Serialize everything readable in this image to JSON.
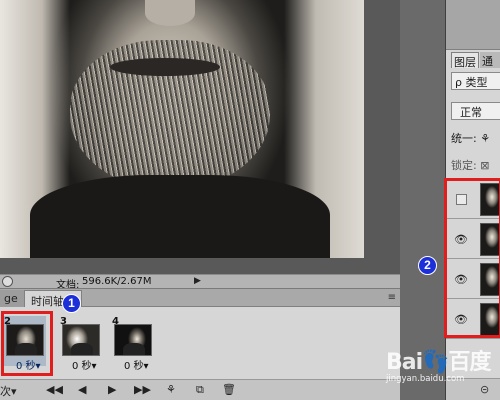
{
  "status_bar": {
    "doc_label": "文档:",
    "doc_value": "596.6K/2.67M",
    "arrow": "▶"
  },
  "timeline": {
    "tab_prev": "ge",
    "tab_active": "时间轴",
    "menu": "≡",
    "frames": [
      {
        "number": "2",
        "delay": "0 秒▾",
        "selected": true
      },
      {
        "number": "3",
        "delay": "0 秒▾",
        "selected": false
      },
      {
        "number": "4",
        "delay": "0 秒▾",
        "selected": false
      }
    ],
    "controls": {
      "loop": "次▾",
      "first_frame": "◀◀",
      "prev_frame": "◀",
      "play": "▶",
      "next_frame": "▶▶",
      "tween": "⚘",
      "duplicate": "⧉",
      "delete": "🗑"
    }
  },
  "layers_panel": {
    "tab_layers": "图层",
    "tab_channels": "通",
    "kind_filter": "ρ 类型",
    "blend_mode": "正常",
    "unify": "统一: ⚘",
    "lock": "锁定: ⊠",
    "layers": [
      {
        "visible": false
      },
      {
        "visible": true
      },
      {
        "visible": true
      },
      {
        "visible": true
      }
    ],
    "eye_glyph": "👁",
    "footer_link": "⊝"
  },
  "annotations": {
    "badge_1": "1",
    "badge_2": "2",
    "highlight_color": "#e01e1e",
    "badge_color": "#1c2fd9"
  },
  "watermark": {
    "text": "Bai👣百度",
    "url": "jingyan.baidu.com"
  }
}
